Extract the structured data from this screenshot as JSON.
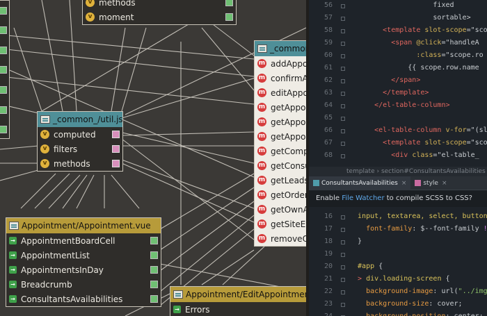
{
  "diagram": {
    "top_node": {
      "items": [
        {
          "icon": "vue-method-icon",
          "label": "methods"
        },
        {
          "icon": "vue-method-icon",
          "label": "moment"
        }
      ]
    },
    "util_node": {
      "title": "_common_/util.js",
      "items": [
        {
          "icon": "vue-method-icon",
          "label": "computed"
        },
        {
          "icon": "vue-method-icon",
          "label": "filters"
        },
        {
          "icon": "vue-method-icon",
          "label": "methods"
        }
      ]
    },
    "common_node": {
      "title": "_common",
      "items": [
        "addAppoi",
        "confirmAp",
        "editAppoi",
        "getAppoir",
        "getAppoir",
        "getAppoi",
        "getCompa",
        "getConsul",
        "getLeadsA",
        "getOrderE",
        "getOwnAp",
        "getSiteEve",
        "removeOr"
      ]
    },
    "appointment_node": {
      "title": "Appointment/Appointment.vue",
      "items": [
        "AppointmentBoardCell",
        "AppointmentList",
        "AppointmentsInDay",
        "Breadcrumb",
        "ConsultantsAvailabilities"
      ]
    },
    "edit_node": {
      "title": "Appointment/EditAppointment.vue",
      "items": [
        "Errors"
      ]
    }
  },
  "editor": {
    "top_lines": [
      {
        "num": "56",
        "parts": [
          {
            "c": "k-plain",
            "t": "                    fixed"
          }
        ]
      },
      {
        "num": "57",
        "parts": [
          {
            "c": "k-plain",
            "t": "                    sortable>"
          }
        ]
      },
      {
        "num": "58",
        "parts": [
          {
            "c": "k-tag",
            "t": "        <template "
          },
          {
            "c": "k-attr",
            "t": "slot-scope"
          },
          {
            "c": "k-plain",
            "t": "=\"scop"
          }
        ]
      },
      {
        "num": "59",
        "parts": [
          {
            "c": "k-tag",
            "t": "          <span "
          },
          {
            "c": "k-attr",
            "t": "@click"
          },
          {
            "c": "k-plain",
            "t": "=\"handleA"
          }
        ]
      },
      {
        "num": "60",
        "parts": [
          {
            "c": "k-attr",
            "t": "                :class"
          },
          {
            "c": "k-plain",
            "t": "=\"scope.ro"
          }
        ]
      },
      {
        "num": "61",
        "parts": [
          {
            "c": "k-plain",
            "t": "              {{ scope.row.name"
          }
        ]
      },
      {
        "num": "62",
        "parts": [
          {
            "c": "k-tag",
            "t": "          </span>"
          }
        ]
      },
      {
        "num": "63",
        "parts": [
          {
            "c": "k-tag",
            "t": "        </template>"
          }
        ]
      },
      {
        "num": "64",
        "parts": [
          {
            "c": "k-tag",
            "t": "      </el-table-column>"
          }
        ]
      },
      {
        "num": "65",
        "parts": [
          {
            "c": "k-plain",
            "t": ""
          }
        ]
      },
      {
        "num": "66",
        "parts": [
          {
            "c": "k-tag",
            "t": "      <el-table-column "
          },
          {
            "c": "k-attr",
            "t": "v-for"
          },
          {
            "c": "k-plain",
            "t": "=\"(slot"
          }
        ]
      },
      {
        "num": "67",
        "parts": [
          {
            "c": "k-tag",
            "t": "        <template "
          },
          {
            "c": "k-attr",
            "t": "slot-scope"
          },
          {
            "c": "k-plain",
            "t": "=\"scop"
          }
        ]
      },
      {
        "num": "68",
        "parts": [
          {
            "c": "k-tag",
            "t": "          <div "
          },
          {
            "c": "k-attr",
            "t": "class"
          },
          {
            "c": "k-plain",
            "t": "=\"el-table_"
          }
        ]
      }
    ],
    "breadcrumb": "template  ›  section#ConsultantsAvailabilities  ›  el-",
    "tabs": [
      {
        "label": "ConsultantsAvailabilities",
        "close": "×",
        "active": true
      },
      {
        "label": "style",
        "close": "×",
        "active": false
      }
    ],
    "notice": {
      "prefix": "Enable ",
      "link": "File Watcher",
      "suffix": " to compile SCSS to CSS?"
    },
    "bottom_lines": [
      {
        "num": "16",
        "parts": [
          {
            "c": "k-sel",
            "t": "  input, textarea, select, button"
          },
          {
            "c": "k-plain",
            "t": " {"
          }
        ]
      },
      {
        "num": "17",
        "parts": [
          {
            "c": "k-prop",
            "t": "    font-family"
          },
          {
            "c": "k-plain",
            "t": ": $--font-family "
          },
          {
            "c": "k-imp",
            "t": "!important"
          },
          {
            "c": "k-plain",
            "t": ";"
          }
        ]
      },
      {
        "num": "18",
        "parts": [
          {
            "c": "k-plain",
            "t": "  }"
          }
        ]
      },
      {
        "num": "19",
        "parts": [
          {
            "c": "k-plain",
            "t": ""
          }
        ]
      },
      {
        "num": "20",
        "parts": [
          {
            "c": "k-sel",
            "t": "  #app"
          },
          {
            "c": "k-plain",
            "t": " {"
          }
        ]
      },
      {
        "num": "21",
        "parts": [
          {
            "c": "k-tag",
            "t": "  > "
          },
          {
            "c": "k-sel",
            "t": "div.loading-screen"
          },
          {
            "c": "k-plain",
            "t": " {"
          }
        ]
      },
      {
        "num": "22",
        "parts": [
          {
            "c": "k-prop",
            "t": "    background-image"
          },
          {
            "c": "k-plain",
            "t": ": url("
          },
          {
            "c": "k-url",
            "t": "\"../img/header-"
          }
        ]
      },
      {
        "num": "23",
        "parts": [
          {
            "c": "k-prop",
            "t": "    background-size"
          },
          {
            "c": "k-plain",
            "t": ": cover;"
          }
        ]
      },
      {
        "num": "24",
        "parts": [
          {
            "c": "k-prop",
            "t": "    background-position"
          },
          {
            "c": "k-plain",
            "t": ": center;"
          }
        ]
      }
    ]
  }
}
